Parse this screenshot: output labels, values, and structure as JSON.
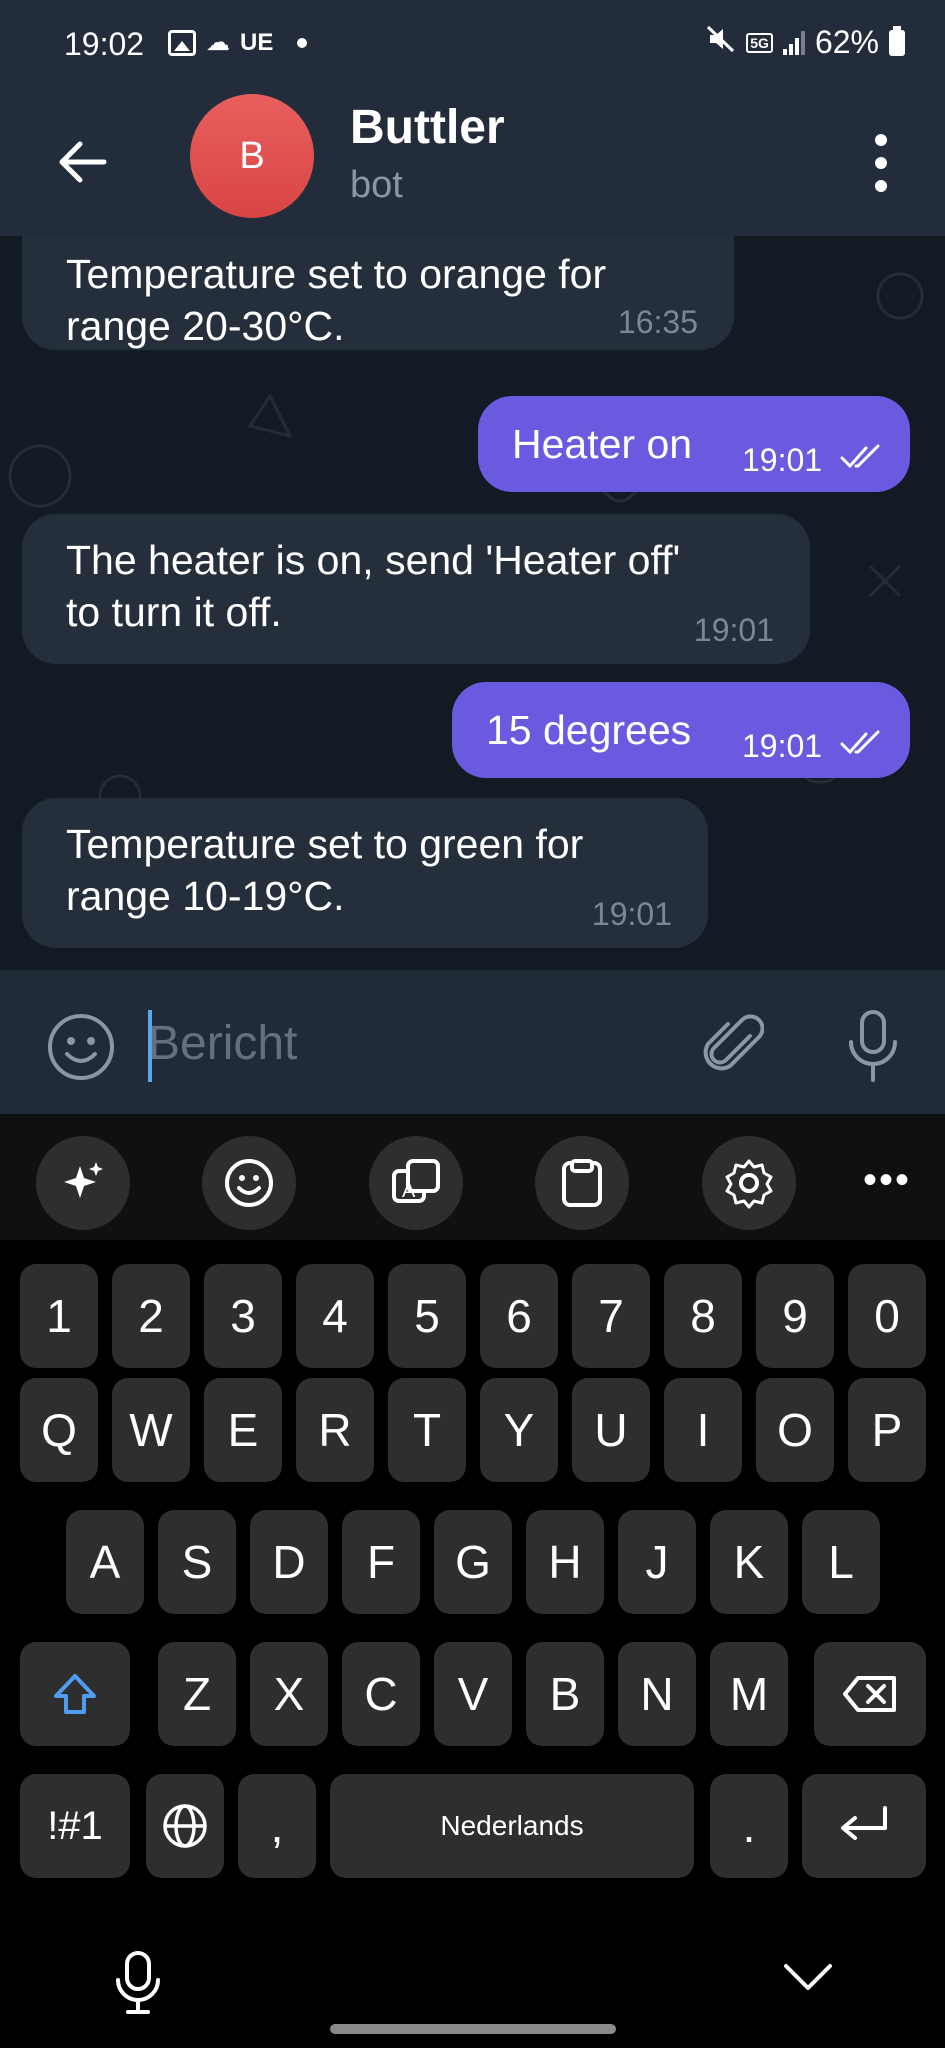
{
  "status_bar": {
    "time": "19:02",
    "carrier_label": "UE",
    "network": "5G",
    "battery": "62%"
  },
  "header": {
    "avatar_letter": "B",
    "title": "Buttler",
    "subtitle": "bot",
    "avatar_color": "#e0504e"
  },
  "messages": [
    {
      "direction": "incoming",
      "lines": [
        "Temperature set to orange for",
        "range 20-30°C."
      ],
      "time": "16:35"
    },
    {
      "direction": "outgoing",
      "lines": [
        "Heater on"
      ],
      "time": "19:01",
      "read": true
    },
    {
      "direction": "incoming",
      "lines": [
        "The heater is on, send 'Heater off'",
        "to turn it off."
      ],
      "time": "19:01"
    },
    {
      "direction": "outgoing",
      "lines": [
        "15 degrees"
      ],
      "time": "19:01",
      "read": true
    },
    {
      "direction": "incoming",
      "lines": [
        "Temperature set to green for",
        "range 10-19°C."
      ],
      "time": "19:01"
    }
  ],
  "composer": {
    "placeholder": "Bericht"
  },
  "keyboard": {
    "toolbar": [
      "ai-sparkle-icon",
      "emoji-icon",
      "translate-icon",
      "clipboard-icon",
      "settings-icon",
      "more-icon"
    ],
    "more_label": "•••",
    "row_numbers": [
      "1",
      "2",
      "3",
      "4",
      "5",
      "6",
      "7",
      "8",
      "9",
      "0"
    ],
    "row1": [
      "Q",
      "W",
      "E",
      "R",
      "T",
      "Y",
      "U",
      "I",
      "O",
      "P"
    ],
    "row2": [
      "A",
      "S",
      "D",
      "F",
      "G",
      "H",
      "J",
      "K",
      "L"
    ],
    "row3": [
      "Z",
      "X",
      "C",
      "V",
      "B",
      "N",
      "M"
    ],
    "symbols_label": "!#1",
    "comma_label": ",",
    "space_label": "Nederlands",
    "period_label": "."
  },
  "colors": {
    "outgoing_bubble": "#6a5ae0",
    "incoming_bubble": "#252f3c",
    "header_bg": "#232c3a",
    "accent_caret": "#5ba8e8",
    "shift_accent": "#4f9cf0"
  }
}
